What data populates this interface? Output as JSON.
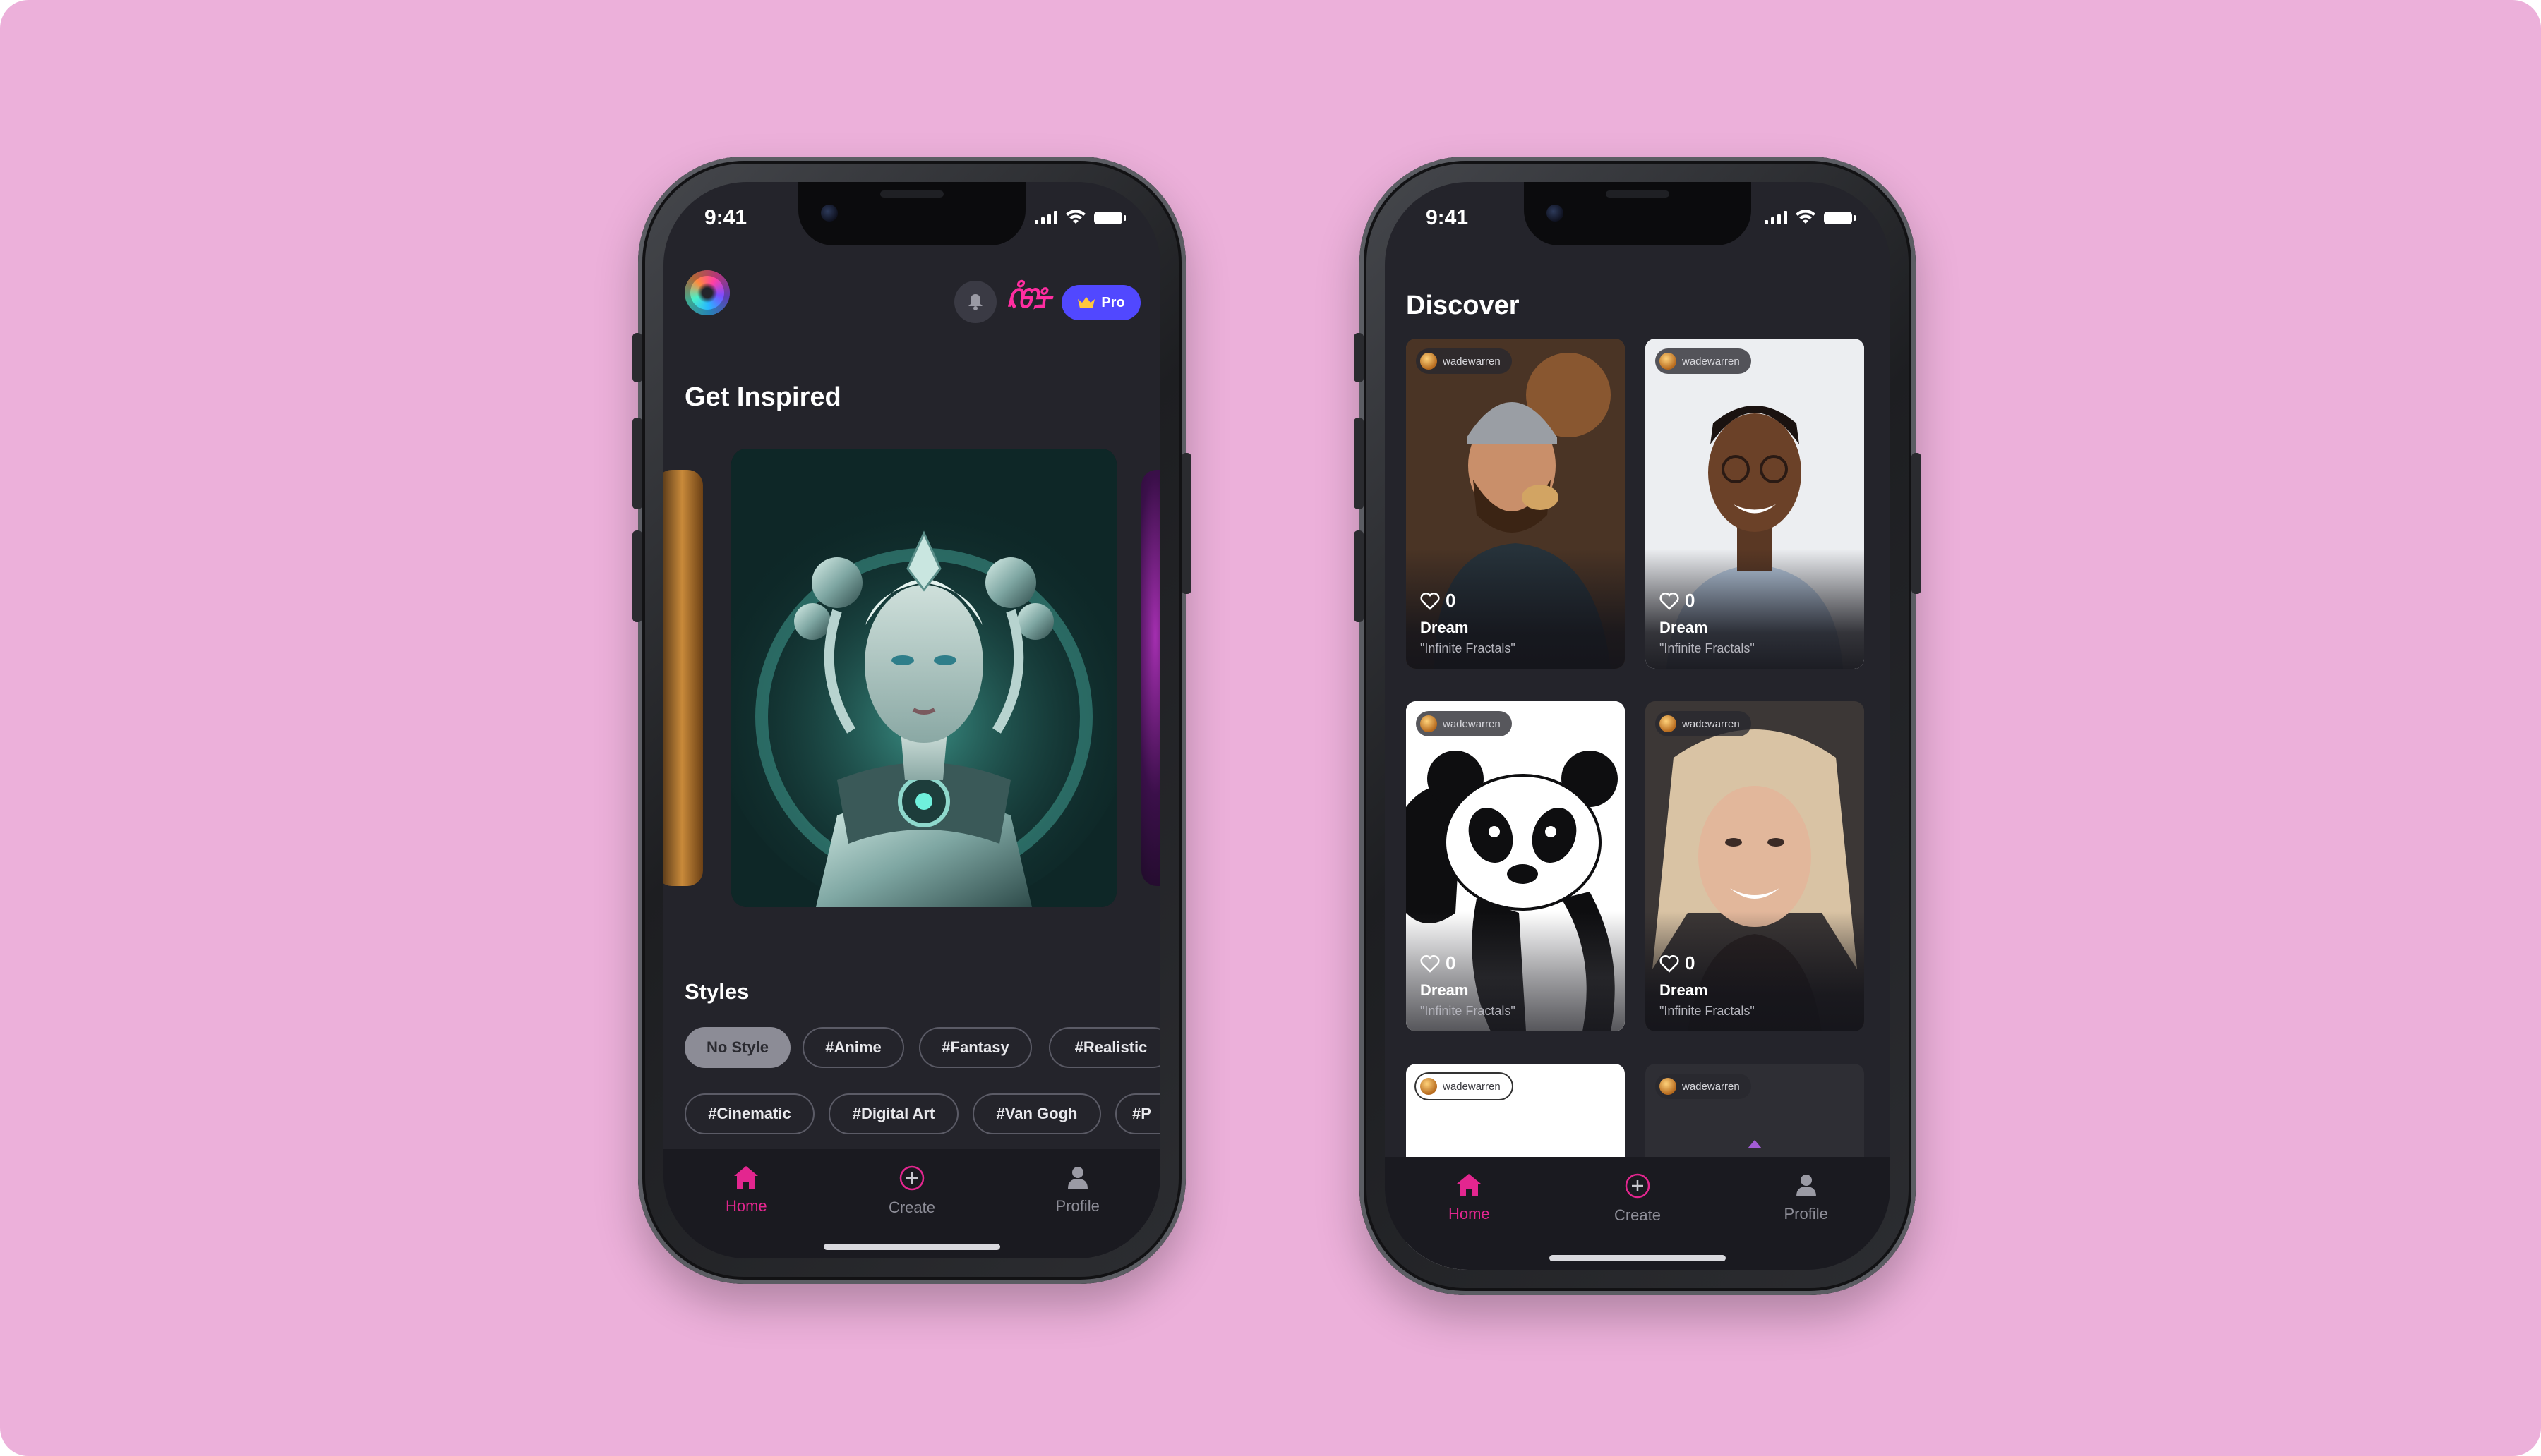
{
  "left_phone": {
    "status": {
      "time": "9:41"
    },
    "header": {
      "pro_label": "Pro",
      "brand_mark": "ᡭᡦᡱ"
    },
    "inspired": {
      "title": "Get Inspired"
    },
    "styles": {
      "title": "Styles",
      "row1": [
        "No Style",
        "#Anime",
        "#Fantasy",
        "#Realistic"
      ],
      "row2": [
        "#Cinematic",
        "#Digital Art",
        "#Van Gogh",
        "#P"
      ]
    },
    "tabs": [
      {
        "label": "Home",
        "icon": "home-icon"
      },
      {
        "label": "Create",
        "icon": "plus-circle-icon"
      },
      {
        "label": "Profile",
        "icon": "person-icon"
      }
    ]
  },
  "right_phone": {
    "status": {
      "time": "9:41"
    },
    "title": "Discover",
    "cards": [
      {
        "user": "wadewarren",
        "likes": "0",
        "style": "Dream",
        "prompt": "\"Infinite Fractals\""
      },
      {
        "user": "wadewarren",
        "likes": "0",
        "style": "Dream",
        "prompt": "\"Infinite Fractals\""
      },
      {
        "user": "wadewarren",
        "likes": "0",
        "style": "Dream",
        "prompt": "\"Infinite Fractals\""
      },
      {
        "user": "wadewarren",
        "likes": "0",
        "style": "Dream",
        "prompt": "\"Infinite Fractals\""
      },
      {
        "user": "wadewarren"
      },
      {
        "user": "wadewarren"
      }
    ],
    "tabs": [
      {
        "label": "Home",
        "icon": "home-icon"
      },
      {
        "label": "Create",
        "icon": "plus-circle-icon"
      },
      {
        "label": "Profile",
        "icon": "person-icon"
      }
    ]
  },
  "colors": {
    "background": "#ecb0da",
    "accent": "#e3268f",
    "pro": "#5148ff",
    "screen": "#24242b"
  }
}
